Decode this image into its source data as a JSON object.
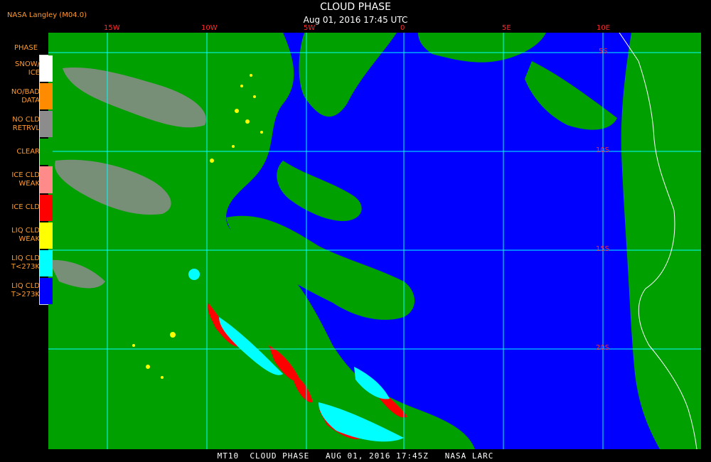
{
  "header": {
    "title": "CLOUD PHASE",
    "subtitle": "Aug 01, 2016 17:45 UTC",
    "brand": "NASA Langley (M04.0)"
  },
  "legend": {
    "title": "PHASE",
    "items": [
      {
        "label": "SNOW/\nICE",
        "color": "#ffffff"
      },
      {
        "label": "NO/BAD\nDATA",
        "color": "#ff8c00"
      },
      {
        "label": "NO CLD\nRETRVL",
        "color": "#8c8c8c"
      },
      {
        "label": "CLEAR",
        "color": "#00a000"
      },
      {
        "label": "ICE CLD\nWEAK",
        "color": "#ff8a8a"
      },
      {
        "label": "ICE CLD",
        "color": "#ff0000"
      },
      {
        "label": "LIQ CLD\nWEAK",
        "color": "#ffff00"
      },
      {
        "label": "LIQ CLD\nT<273K",
        "color": "#00ffff"
      },
      {
        "label": "LIQ CLD\nT>273K",
        "color": "#0000ff"
      }
    ]
  },
  "map": {
    "lon_labels": [
      "15W",
      "10W",
      "5W",
      "0",
      "5E",
      "10E"
    ],
    "lat_labels": [
      "5S",
      "10S",
      "15S",
      "20S"
    ],
    "grid_color": "#00ffff",
    "coast_color": "#ffffff"
  },
  "footer": {
    "text": "MT10  CLOUD PHASE   AUG 01, 2016 17:45Z   NASA LARC"
  }
}
